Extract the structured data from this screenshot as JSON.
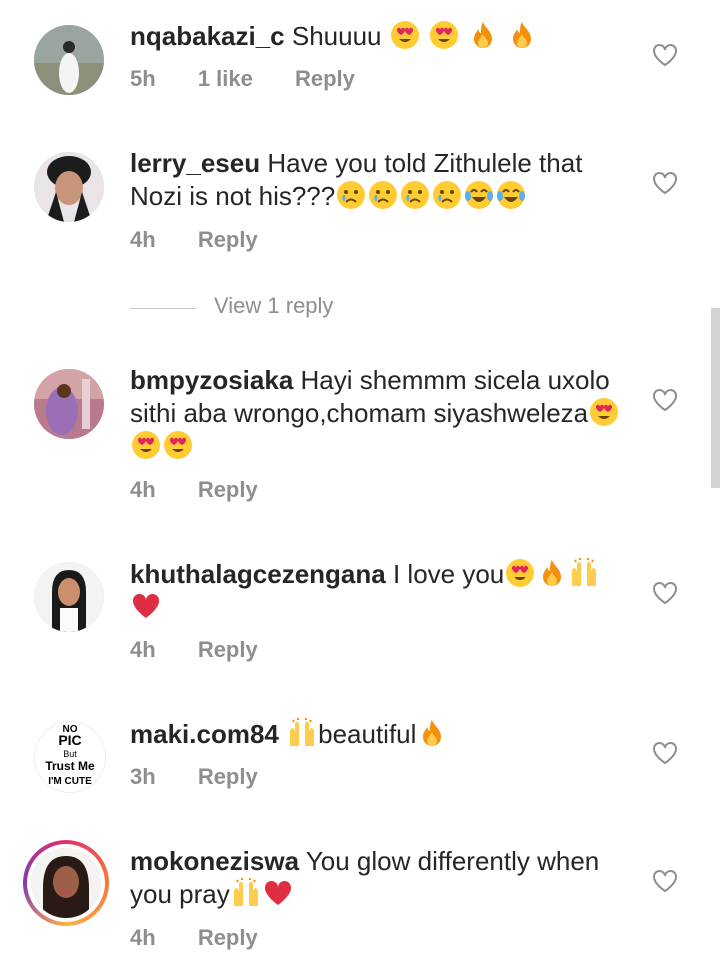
{
  "comments": [
    {
      "username": "nqabakazi_c",
      "text": "Shuuuu",
      "emojis": [
        "heart-eyes",
        "heart-eyes",
        "fire",
        "fire"
      ],
      "time": "5h",
      "likes": "1 like",
      "reply": "Reply"
    },
    {
      "username": "lerry_eseu",
      "text": "Have you told Zithulele that Nozi is not his???",
      "emojis": [
        "crying-face",
        "crying-face",
        "crying-face",
        "crying-face",
        "tears-of-joy",
        "tears-of-joy"
      ],
      "time": "4h",
      "reply": "Reply",
      "view_replies": "View 1 reply"
    },
    {
      "username": "bmpyzosiaka",
      "text": "Hayi shemmm sicela uxolo sithi aba wrongo,chomam siyashweleza",
      "emojis": [
        "heart-eyes",
        "heart-eyes",
        "heart-eyes"
      ],
      "time": "4h",
      "reply": "Reply"
    },
    {
      "username": "khuthalagcezengana",
      "text": "I love you",
      "emojis": [
        "heart-eyes",
        "fire",
        "raising-hands",
        "red-heart"
      ],
      "time": "4h",
      "reply": "Reply"
    },
    {
      "username": "maki.com84",
      "text_before": "",
      "text": "beautiful",
      "emojis_before": [
        "raising-hands"
      ],
      "emojis": [
        "fire"
      ],
      "time": "3h",
      "reply": "Reply",
      "avatar_text": [
        "NO",
        "PIC",
        "But",
        "Trust Me",
        "I'M CUTE"
      ]
    },
    {
      "username": "mokoneziswa",
      "text": "You glow differently when you pray",
      "emojis": [
        "raising-hands",
        "red-heart"
      ],
      "time": "4h",
      "reply": "Reply"
    }
  ]
}
